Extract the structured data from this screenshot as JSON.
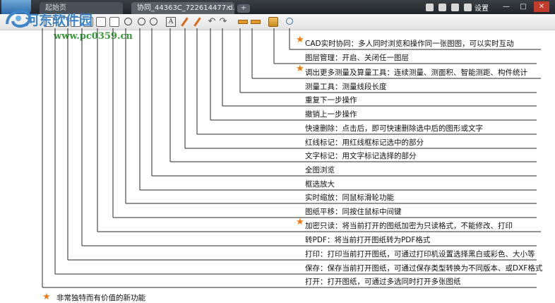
{
  "window": {
    "tab_start": "起始页",
    "tab_file": "协同_44363C_722614477.d...",
    "tab_close": "×",
    "tab_add": "+",
    "settings": "设置",
    "minimize": "—",
    "maximize": "□",
    "close": "✕"
  },
  "toolbar": {
    "text_tool": "A",
    "undo": "↶",
    "redo": "↷"
  },
  "watermark": {
    "site_name": "河东软件园",
    "url": "www.pc0359.cn"
  },
  "annotations": [
    {
      "text": "CAD实时协同：多人同时浏览和操作同一张图图，可以实时互动",
      "star": true
    },
    {
      "text": "图层管理：开启、关闭任一图层",
      "star": false
    },
    {
      "text": "调出更多测量及算量工具：连续测量、测面积、智能测距、构件统计",
      "star": true
    },
    {
      "text": "测量工具：测量线段长度",
      "star": false
    },
    {
      "text": "重复下一步操作",
      "star": false
    },
    {
      "text": "撤销上一步操作",
      "star": false
    },
    {
      "text": "快速删除：点击后，即可快速删除选中后的图形或文字",
      "star": false
    },
    {
      "text": "红线标记：用红线框标记选中的部分",
      "star": false
    },
    {
      "text": "文字标记：用文字标记选择的部分",
      "star": false
    },
    {
      "text": "全图浏览",
      "star": false
    },
    {
      "text": "框选放大",
      "star": false
    },
    {
      "text": "实时缩放：同鼠标滑轮功能",
      "star": false
    },
    {
      "text": "图纸平移：同按住鼠标中间键",
      "star": false
    },
    {
      "text": "加密只读：将当前打开的图纸加密为只读格式，不能修改、打印",
      "star": true
    },
    {
      "text": "转PDF：将当前打开图纸转为PDF格式",
      "star": false
    },
    {
      "text": "打印：打印当前打开图纸，可通过打印机设置选择黑白或彩色、大小等",
      "star": false
    },
    {
      "text": "保存：保存当前打开图纸，可通过保存类型转换为不同版本、或DXF格式",
      "star": false
    },
    {
      "text": "打开：打开图纸，可通过多选同时打开多张图纸",
      "star": false
    }
  ],
  "legend": {
    "star_symbol": "★",
    "text": "非常独特而有价值的新功能"
  },
  "colors": {
    "star": "#f07810",
    "titlebar": "#2c3036",
    "watermark_blue": "#3f86c8",
    "watermark_green": "#3a9a3a"
  }
}
